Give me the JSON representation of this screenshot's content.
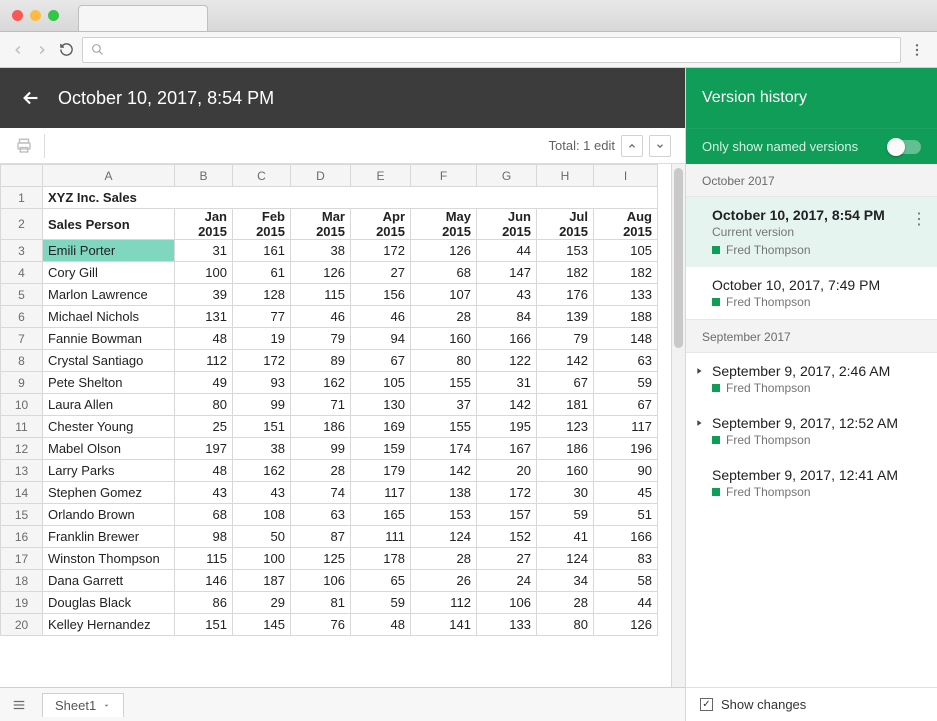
{
  "header": {
    "title": "October 10, 2017, 8:54 PM"
  },
  "subbar": {
    "total_text": "Total: 1 edit"
  },
  "columns_letters": [
    "A",
    "B",
    "C",
    "D",
    "E",
    "F",
    "G",
    "H",
    "I"
  ],
  "title_row": "XYZ Inc. Sales",
  "headers": [
    "Sales Person",
    "Jan 2015",
    "Feb 2015",
    "Mar 2015",
    "Apr 2015",
    "May 2015",
    "Jun 2015",
    "Jul 2015",
    "Aug 2015"
  ],
  "rows": [
    {
      "n": 3,
      "hl": true,
      "name": "Emili Porter",
      "vals": [
        31,
        161,
        38,
        172,
        126,
        44,
        153,
        105
      ]
    },
    {
      "n": 4,
      "hl": false,
      "name": "Cory Gill",
      "vals": [
        100,
        61,
        126,
        27,
        68,
        147,
        182,
        182
      ]
    },
    {
      "n": 5,
      "hl": false,
      "name": "Marlon Lawrence",
      "vals": [
        39,
        128,
        115,
        156,
        107,
        43,
        176,
        133
      ]
    },
    {
      "n": 6,
      "hl": false,
      "name": "Michael Nichols",
      "vals": [
        131,
        77,
        46,
        46,
        28,
        84,
        139,
        188
      ]
    },
    {
      "n": 7,
      "hl": false,
      "name": "Fannie Bowman",
      "vals": [
        48,
        19,
        79,
        94,
        160,
        166,
        79,
        148
      ]
    },
    {
      "n": 8,
      "hl": false,
      "name": "Crystal Santiago",
      "vals": [
        112,
        172,
        89,
        67,
        80,
        122,
        142,
        63
      ]
    },
    {
      "n": 9,
      "hl": false,
      "name": "Pete Shelton",
      "vals": [
        49,
        93,
        162,
        105,
        155,
        31,
        67,
        59
      ]
    },
    {
      "n": 10,
      "hl": false,
      "name": "Laura Allen",
      "vals": [
        80,
        99,
        71,
        130,
        37,
        142,
        181,
        67
      ]
    },
    {
      "n": 11,
      "hl": false,
      "name": "Chester Young",
      "vals": [
        25,
        151,
        186,
        169,
        155,
        195,
        123,
        117
      ]
    },
    {
      "n": 12,
      "hl": false,
      "name": "Mabel Olson",
      "vals": [
        197,
        38,
        99,
        159,
        174,
        167,
        186,
        196
      ]
    },
    {
      "n": 13,
      "hl": false,
      "name": "Larry Parks",
      "vals": [
        48,
        162,
        28,
        179,
        142,
        20,
        160,
        90
      ]
    },
    {
      "n": 14,
      "hl": false,
      "name": "Stephen Gomez",
      "vals": [
        43,
        43,
        74,
        117,
        138,
        172,
        30,
        45
      ]
    },
    {
      "n": 15,
      "hl": false,
      "name": "Orlando Brown",
      "vals": [
        68,
        108,
        63,
        165,
        153,
        157,
        59,
        51
      ]
    },
    {
      "n": 16,
      "hl": false,
      "name": "Franklin Brewer",
      "vals": [
        98,
        50,
        87,
        111,
        124,
        152,
        41,
        166
      ]
    },
    {
      "n": 17,
      "hl": false,
      "name": "Winston Thompson",
      "vals": [
        115,
        100,
        125,
        178,
        28,
        27,
        124,
        83
      ]
    },
    {
      "n": 18,
      "hl": false,
      "name": "Dana Garrett",
      "vals": [
        146,
        187,
        106,
        65,
        26,
        24,
        34,
        58
      ]
    },
    {
      "n": 19,
      "hl": false,
      "name": "Douglas Black",
      "vals": [
        86,
        29,
        81,
        59,
        112,
        106,
        28,
        44
      ]
    },
    {
      "n": 20,
      "hl": false,
      "name": "Kelley Hernandez",
      "vals": [
        151,
        145,
        76,
        48,
        141,
        133,
        80,
        126
      ]
    }
  ],
  "footer": {
    "sheet_tab": "Sheet1"
  },
  "side": {
    "title": "Version history",
    "toggle_label": "Only show named versions",
    "months": [
      {
        "label": "October 2017",
        "versions": [
          {
            "title": "October 10, 2017, 8:54 PM",
            "sub": "Current version",
            "author": "Fred Thompson",
            "active": true,
            "expandable": false,
            "kebab": true
          },
          {
            "title": "October 10, 2017, 7:49 PM",
            "sub": "",
            "author": "Fred Thompson",
            "active": false,
            "expandable": false,
            "kebab": false
          }
        ]
      },
      {
        "label": "September 2017",
        "versions": [
          {
            "title": "September 9, 2017, 2:46 AM",
            "sub": "",
            "author": "Fred Thompson",
            "active": false,
            "expandable": true,
            "kebab": false
          },
          {
            "title": "September 9, 2017, 12:52 AM",
            "sub": "",
            "author": "Fred Thompson",
            "active": false,
            "expandable": true,
            "kebab": false
          },
          {
            "title": "September 9, 2017, 12:41 AM",
            "sub": "",
            "author": "Fred Thompson",
            "active": false,
            "expandable": false,
            "kebab": false
          }
        ]
      }
    ],
    "show_changes": "Show changes"
  },
  "chart_data": {
    "type": "table",
    "title": "XYZ Inc. Sales",
    "columns": [
      "Sales Person",
      "Jan 2015",
      "Feb 2015",
      "Mar 2015",
      "Apr 2015",
      "May 2015",
      "Jun 2015",
      "Jul 2015",
      "Aug 2015"
    ],
    "rows": [
      [
        "Emili Porter",
        31,
        161,
        38,
        172,
        126,
        44,
        153,
        105
      ],
      [
        "Cory Gill",
        100,
        61,
        126,
        27,
        68,
        147,
        182,
        182
      ],
      [
        "Marlon Lawrence",
        39,
        128,
        115,
        156,
        107,
        43,
        176,
        133
      ],
      [
        "Michael Nichols",
        131,
        77,
        46,
        46,
        28,
        84,
        139,
        188
      ],
      [
        "Fannie Bowman",
        48,
        19,
        79,
        94,
        160,
        166,
        79,
        148
      ],
      [
        "Crystal Santiago",
        112,
        172,
        89,
        67,
        80,
        122,
        142,
        63
      ],
      [
        "Pete Shelton",
        49,
        93,
        162,
        105,
        155,
        31,
        67,
        59
      ],
      [
        "Laura Allen",
        80,
        99,
        71,
        130,
        37,
        142,
        181,
        67
      ],
      [
        "Chester Young",
        25,
        151,
        186,
        169,
        155,
        195,
        123,
        117
      ],
      [
        "Mabel Olson",
        197,
        38,
        99,
        159,
        174,
        167,
        186,
        196
      ],
      [
        "Larry Parks",
        48,
        162,
        28,
        179,
        142,
        20,
        160,
        90
      ],
      [
        "Stephen Gomez",
        43,
        43,
        74,
        117,
        138,
        172,
        30,
        45
      ],
      [
        "Orlando Brown",
        68,
        108,
        63,
        165,
        153,
        157,
        59,
        51
      ],
      [
        "Franklin Brewer",
        98,
        50,
        87,
        111,
        124,
        152,
        41,
        166
      ],
      [
        "Winston Thompson",
        115,
        100,
        125,
        178,
        28,
        27,
        124,
        83
      ],
      [
        "Dana Garrett",
        146,
        187,
        106,
        65,
        26,
        24,
        34,
        58
      ],
      [
        "Douglas Black",
        86,
        29,
        81,
        59,
        112,
        106,
        28,
        44
      ],
      [
        "Kelley Hernandez",
        151,
        145,
        76,
        48,
        141,
        133,
        80,
        126
      ]
    ]
  }
}
